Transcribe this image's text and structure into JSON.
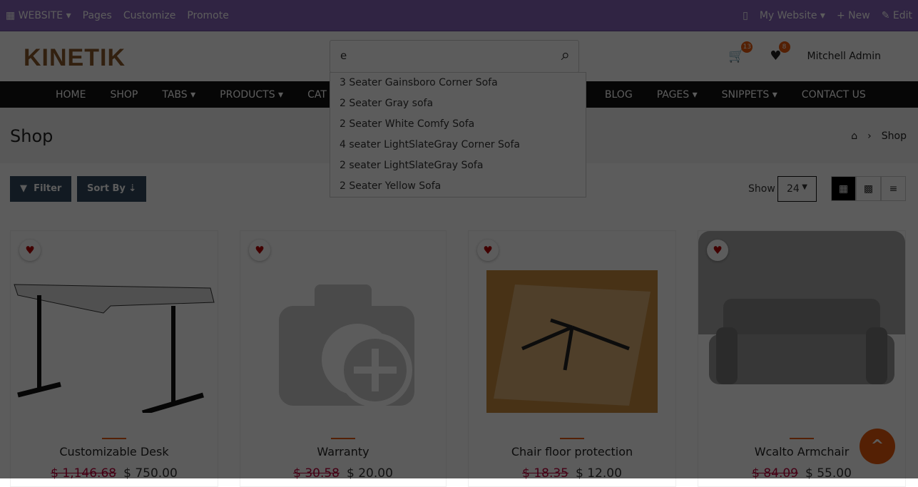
{
  "topbar": {
    "website": "WEBSITE",
    "pages": "Pages",
    "customize": "Customize",
    "promote": "Promote",
    "my_website": "My Website",
    "new": "New",
    "edit": "Edit"
  },
  "header": {
    "logo": "KINETIK",
    "search_value": "e",
    "cart_count": "13",
    "wishlist_count": "8",
    "user": "Mitchell Admin"
  },
  "nav": [
    "HOME",
    "SHOP",
    "TABS",
    "PRODUCTS",
    "CAT",
    "BLOG",
    "PAGES",
    "SNIPPETS",
    "CONTACT US"
  ],
  "suggestions": [
    "3 Seater Gainsboro Corner Sofa",
    "2 Seater Gray sofa",
    "2 Seater White Comfy Sofa",
    "4 seater LightSlateGray Corner Sofa",
    "2 seater LightSlateGray Sofa",
    "2 Seater Yellow Sofa"
  ],
  "page": {
    "title": "Shop",
    "breadcrumb": "Shop"
  },
  "toolbar": {
    "filter": "Filter",
    "sort": "Sort By",
    "show": "Show",
    "per_page": "24"
  },
  "products": [
    {
      "name": "Customizable Desk",
      "old": "$ 1,146.68",
      "price": "$ 750.00"
    },
    {
      "name": "Warranty",
      "old": "$ 30.58",
      "price": "$ 20.00"
    },
    {
      "name": "Chair floor protection",
      "old": "$ 18.35",
      "price": "$ 12.00"
    },
    {
      "name": "Wcalto Armchair",
      "old": "$ 84.09",
      "price": "$ 55.00"
    }
  ]
}
